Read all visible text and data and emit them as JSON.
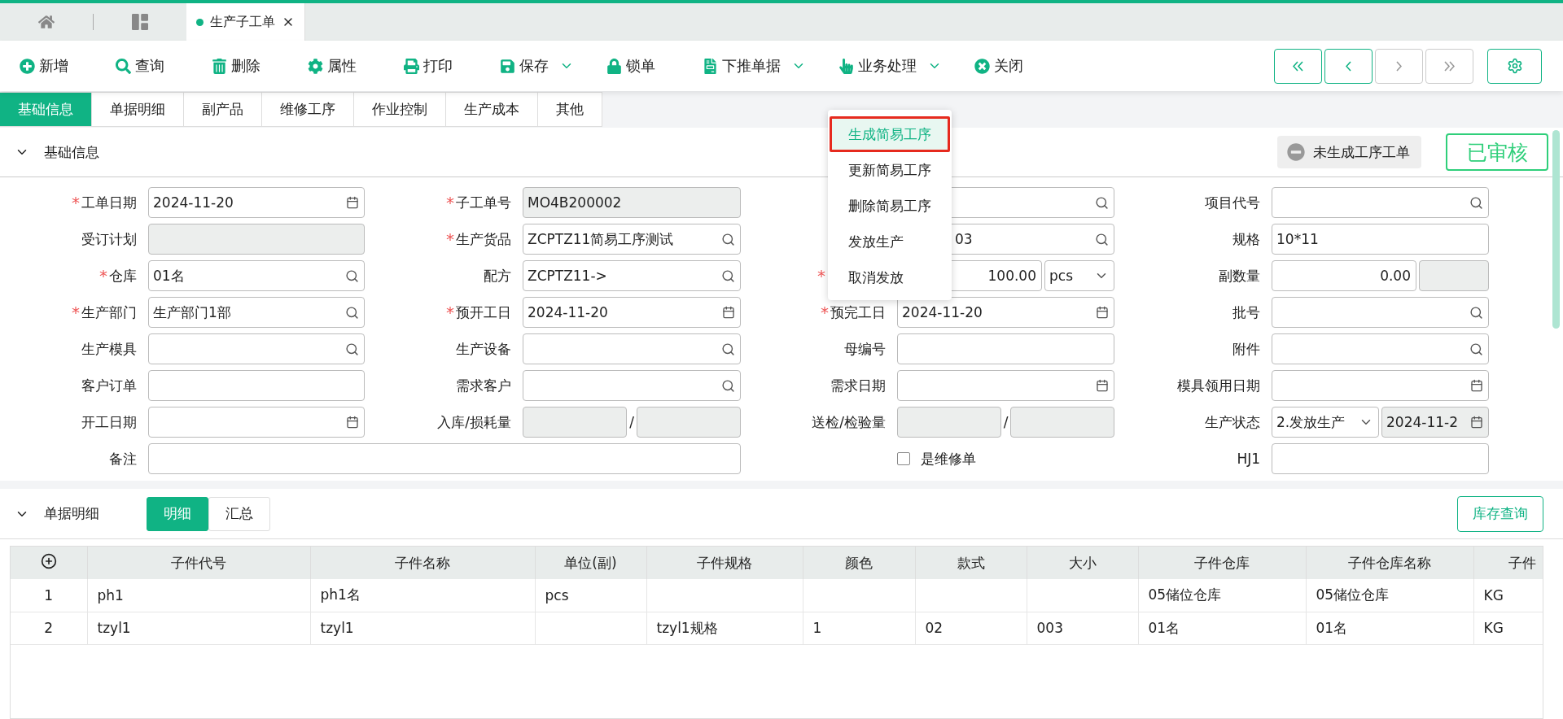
{
  "doc_tabs": [
    {
      "label": "生产子工单",
      "selected": true
    }
  ],
  "toolbar": [
    {
      "kind": "add",
      "label": "新增",
      "dropdown": false
    },
    {
      "kind": "query",
      "label": "查询",
      "dropdown": false
    },
    {
      "kind": "delete",
      "label": "删除",
      "dropdown": false
    },
    {
      "kind": "props",
      "label": "属性",
      "dropdown": false
    },
    {
      "kind": "print",
      "label": "打印",
      "dropdown": false
    },
    {
      "kind": "save",
      "label": "保存",
      "dropdown": true
    },
    {
      "kind": "lock",
      "label": "锁单",
      "dropdown": false
    },
    {
      "kind": "push",
      "label": "下推单据",
      "dropdown": true
    },
    {
      "kind": "process",
      "label": "业务处理",
      "dropdown": true
    },
    {
      "kind": "close",
      "label": "关闭",
      "dropdown": false
    }
  ],
  "nav_buttons": [
    {
      "kind": "first",
      "disabled": false
    },
    {
      "kind": "prev",
      "disabled": false
    },
    {
      "kind": "next",
      "disabled": true
    },
    {
      "kind": "last",
      "disabled": true
    }
  ],
  "section_tabs": [
    {
      "label": "基础信息",
      "selected": true
    },
    {
      "label": "单据明细",
      "selected": false
    },
    {
      "label": "副产品",
      "selected": false
    },
    {
      "label": "维修工序",
      "selected": false
    },
    {
      "label": "作业控制",
      "selected": false
    },
    {
      "label": "生产成本",
      "selected": false
    },
    {
      "label": "其他",
      "selected": false
    }
  ],
  "basic_section": {
    "title": "基础信息",
    "expanded": true,
    "status_badge": "未生成工序工单",
    "stamp": "已审核"
  },
  "form_rows": [
    [
      {
        "kind": "date",
        "label": "工单日期",
        "required_mark": "*",
        "value": "2024-11-20"
      },
      {
        "kind": "disabled",
        "label": "子工单号",
        "required_mark": "*",
        "value": "MO4B200002"
      },
      {
        "kind": "search"
      },
      {
        "kind": "search",
        "label": "项目代号"
      }
    ],
    [
      {
        "kind": "disabled",
        "label": "受订计划"
      },
      {
        "kind": "search",
        "label": "生产货品",
        "required_mark": "*",
        "value": "ZCPTZ11简易工序测试"
      },
      {
        "kind": "search-covered",
        "value": "03"
      },
      {
        "kind": "text",
        "label": "规格",
        "value": "10*11"
      }
    ],
    [
      {
        "kind": "search",
        "label": "仓库",
        "required_mark": "*",
        "value": "01名"
      },
      {
        "kind": "search",
        "label": "配方",
        "value": "ZCPTZ11->"
      },
      {
        "kind": "qty-unit",
        "required_mark": "*",
        "value": "100.00",
        "unit": "pcs"
      },
      {
        "kind": "qty-extra",
        "label": "副数量",
        "value": "0.00"
      }
    ],
    [
      {
        "kind": "search",
        "label": "生产部门",
        "required_mark": "*",
        "value": "生产部门1部"
      },
      {
        "kind": "date",
        "label": "预开工日",
        "required_mark": "*",
        "value": "2024-11-20"
      },
      {
        "kind": "date",
        "label": "预完工日",
        "required_mark": "*",
        "value": "2024-11-20"
      },
      {
        "kind": "search",
        "label": "批号"
      }
    ],
    [
      {
        "kind": "search",
        "label": "生产模具"
      },
      {
        "kind": "search",
        "label": "生产设备"
      },
      {
        "kind": "text",
        "label": "母编号"
      },
      {
        "kind": "search",
        "label": "附件"
      }
    ],
    [
      {
        "kind": "text",
        "label": "客户订单"
      },
      {
        "kind": "search",
        "label": "需求客户"
      },
      {
        "kind": "date",
        "label": "需求日期"
      },
      {
        "kind": "date",
        "label": "模具领用日期"
      }
    ],
    [
      {
        "kind": "date",
        "label": "开工日期"
      },
      {
        "kind": "pair",
        "label": "入库/损耗量",
        "separator": "/"
      },
      {
        "kind": "pair",
        "label": "送检/检验量",
        "separator": "/"
      },
      {
        "kind": "select-date",
        "label": "生产状态",
        "value": "2.发放生产",
        "date": "2024-11-2"
      }
    ],
    [
      {
        "kind": "wide",
        "label": "备注"
      },
      {
        "kind": "checkbox",
        "label": "是维修单",
        "checked": false
      },
      {
        "kind": "text",
        "label": "HJ1"
      }
    ]
  ],
  "process_menu": {
    "items": [
      {
        "label": "生成简易工序",
        "selected": true
      },
      {
        "label": "更新简易工序",
        "selected": false
      },
      {
        "label": "删除简易工序",
        "selected": false
      },
      {
        "label": "发放生产",
        "selected": false
      },
      {
        "label": "取消发放",
        "selected": false
      }
    ]
  },
  "detail_section": {
    "title": "单据明细",
    "expanded": true,
    "toggle": [
      {
        "label": "明细",
        "selected": true
      },
      {
        "label": "汇总",
        "selected": false
      }
    ],
    "stock_button": "库存查询"
  },
  "table": {
    "columns": [
      "",
      "子件代号",
      "子件名称",
      "单位(副)",
      "子件规格",
      "颜色",
      "款式",
      "大小",
      "子件仓库",
      "子件仓库名称",
      "子件"
    ],
    "rows": [
      [
        "1",
        "ph1",
        "ph1名",
        "pcs",
        "",
        "",
        "",
        "",
        "05储位仓库",
        "05储位仓库",
        "KG"
      ],
      [
        "2",
        "tzyl1",
        "tzyl1",
        "",
        "tzyl1规格",
        "1",
        "02",
        "003",
        "01名",
        "01名",
        "KG"
      ]
    ]
  }
}
